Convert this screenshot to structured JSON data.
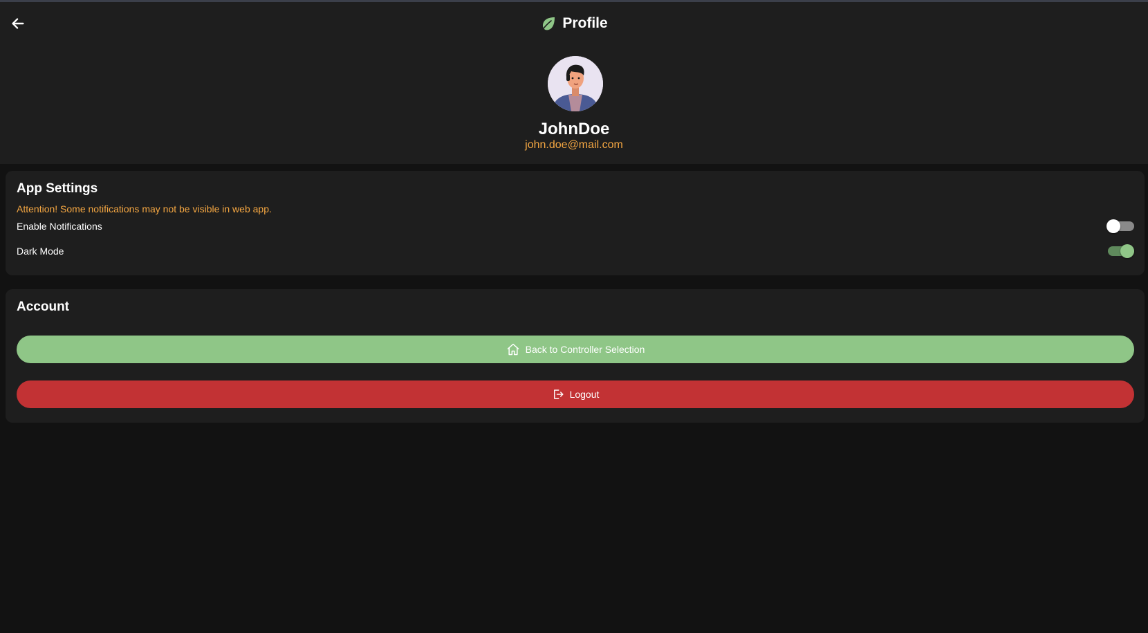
{
  "header": {
    "title": "Profile",
    "back_icon": "arrow-left-icon",
    "logo_icon": "leaf-icon"
  },
  "profile": {
    "username": "JohnDoe",
    "email": "john.doe@mail.com"
  },
  "app_settings": {
    "title": "App Settings",
    "attention": "Attention! Some notifications may not be visible in web app.",
    "settings": [
      {
        "label": "Enable Notifications",
        "enabled": false
      },
      {
        "label": "Dark Mode",
        "enabled": true
      }
    ]
  },
  "account": {
    "title": "Account",
    "back_button_label": "Back to Controller Selection",
    "back_button_icon": "home-icon",
    "logout_label": "Logout",
    "logout_icon": "logout-icon"
  },
  "colors": {
    "accent_green": "#8fc687",
    "danger_red": "#c23234",
    "warning_orange": "#f5a742",
    "card_bg": "#1e1e1e",
    "page_bg": "#121212"
  }
}
